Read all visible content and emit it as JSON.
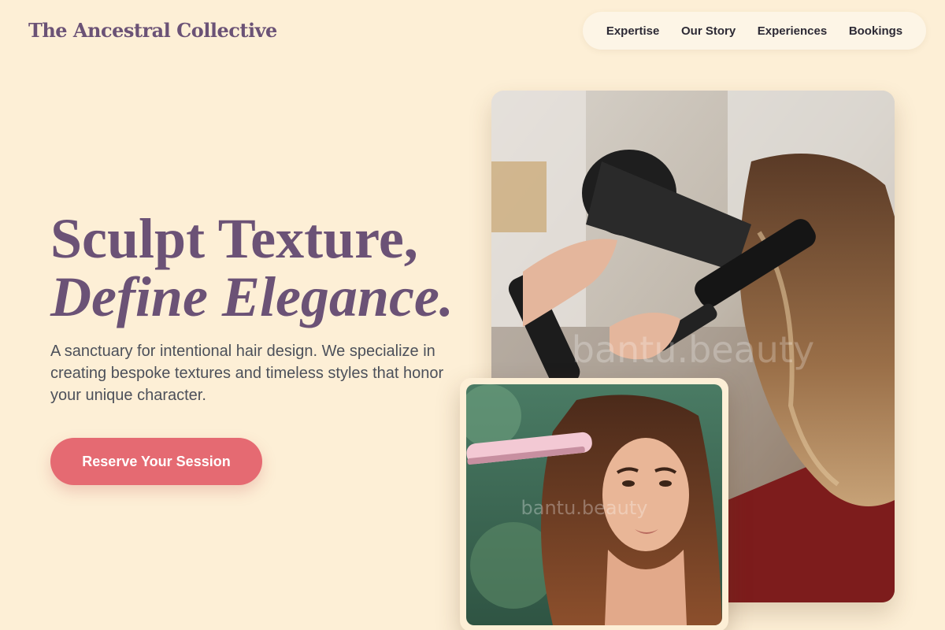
{
  "brand": "The Ancestral Collective",
  "nav": {
    "items": [
      {
        "label": "Expertise"
      },
      {
        "label": "Our Story"
      },
      {
        "label": "Experiences"
      },
      {
        "label": "Bookings"
      }
    ]
  },
  "hero": {
    "headline_line1": "Sculpt Texture,",
    "headline_line2": "Define Elegance.",
    "lead": "A sanctuary for intentional hair design. We specialize in creating bespoke textures and timeless styles that honor your unique character.",
    "cta_label": "Reserve Your Session"
  },
  "images": {
    "main_watermark": "bantu.beauty",
    "inset_watermark": "bantu.beauty"
  },
  "colors": {
    "background": "#fdefd6",
    "brand": "#6b5276",
    "accent": "#e56a72"
  }
}
